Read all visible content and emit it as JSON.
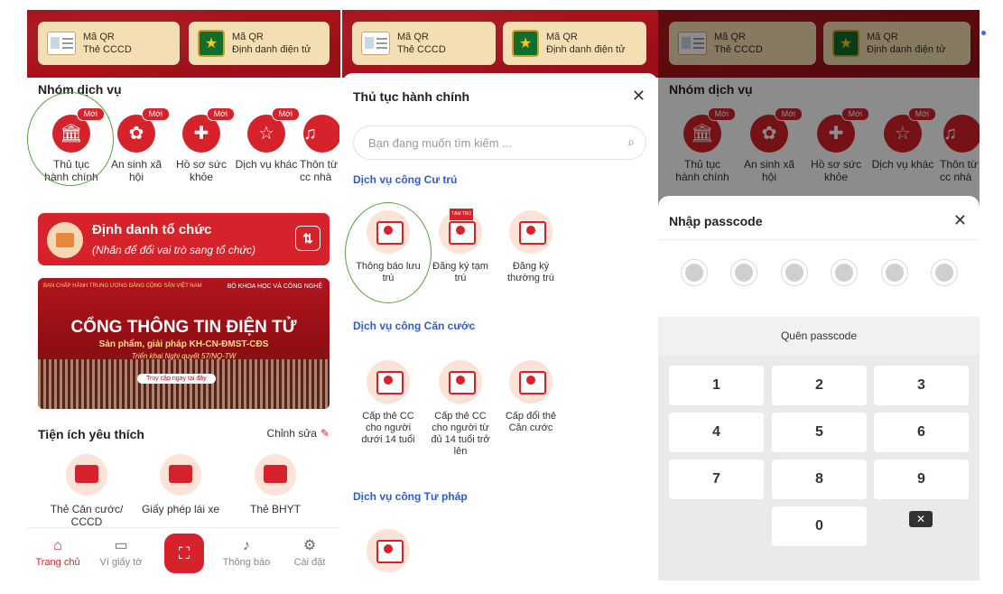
{
  "qr": {
    "label": "Mã QR",
    "cccd": "Thẻ CCCD",
    "did": "Định danh điện tử"
  },
  "p1": {
    "section": "Nhóm dịch vụ",
    "services": [
      {
        "label": "Thủ tục hành chính",
        "badge": "Mới"
      },
      {
        "label": "An sinh xã hội",
        "badge": "Mới"
      },
      {
        "label": "Hồ sơ sức khỏe",
        "badge": "Mới"
      },
      {
        "label": "Dịch vụ khác",
        "badge": "Mới"
      },
      {
        "label": "Thôn từ cc nhà",
        "badge": ""
      }
    ],
    "org_title": "Định danh tổ chức",
    "org_sub": "(Nhấn để đổi vai trò sang tổ chức)",
    "banner": {
      "top": "BAN CHẤP HÀNH TRUNG ƯƠNG ĐẢNG CỘNG SẢN VIỆT NAM",
      "tr": "BỘ KHOA HỌC VÀ CÔNG NGHỆ",
      "title": "CỔNG THÔNG TIN ĐIỆN TỬ",
      "sub": "Sản phẩm, giải pháp KH-CN-ĐMST-CĐS",
      "sub2": "Triển khai Nghị quyết 57/NQ-TW",
      "btn": "Truy cập ngay tại đây"
    },
    "fav_title": "Tiện ích yêu thích",
    "edit": "Chỉnh sửa",
    "favs": [
      "Thẻ Căn cước/ CCCD",
      "Giấy phép lái xe",
      "Thẻ BHYT"
    ],
    "nav": {
      "home": "Trang chủ",
      "wallet": "Ví giấy tờ",
      "notif": "Thông báo",
      "settings": "Cài đặt"
    }
  },
  "p2": {
    "title": "Thủ tục hành chính",
    "search_placeholder": "Bạn đang muốn tìm kiếm ...",
    "cat1": "Dịch vụ công Cư trú",
    "cat1_items": [
      "Thông báo lưu trú",
      "Đăng ký tạm trú",
      "Đăng ký thường trú"
    ],
    "cat2": "Dịch vụ công Căn cước",
    "cat2_items": [
      "Cấp thẻ CC cho người dưới 14 tuổi",
      "Cấp thẻ CC cho người từ đủ 14 tuổi trở lên",
      "Cấp đổi thẻ Căn cước"
    ],
    "cat3": "Dịch vụ công Tư pháp",
    "tamtru_tag": "TẠM TRÚ"
  },
  "p3": {
    "title": "Nhập passcode",
    "forgot": "Quên passcode",
    "keys": [
      "1",
      "2",
      "3",
      "4",
      "5",
      "6",
      "7",
      "8",
      "9",
      "0"
    ]
  }
}
